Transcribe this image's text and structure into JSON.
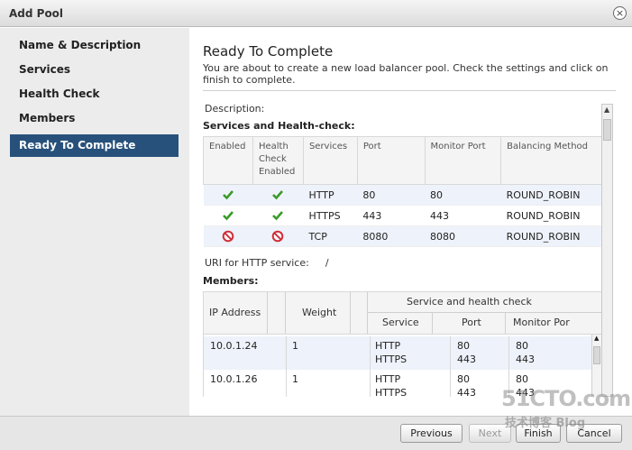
{
  "dialog": {
    "title": "Add Pool",
    "close_symbol": "×"
  },
  "sidebar": {
    "items": [
      {
        "label": "Name & Description"
      },
      {
        "label": "Services"
      },
      {
        "label": "Health Check"
      },
      {
        "label": "Members"
      },
      {
        "label": "Ready To Complete",
        "active": true
      }
    ]
  },
  "main": {
    "title": "Ready To Complete",
    "description": "You are about to create a new load balancer pool. Check the settings and click on finish to complete.",
    "description_field_label": "Description:",
    "services_section_title": "Services and Health-check:",
    "services_table": {
      "headers": [
        "Enabled",
        "Health Check Enabled",
        "Services",
        "Port",
        "Monitor Port",
        "Balancing Method"
      ],
      "rows": [
        {
          "enabled": "check-icon",
          "health": "check-icon",
          "service": "HTTP",
          "port": "80",
          "monitor_port": "80",
          "method": "ROUND_ROBIN"
        },
        {
          "enabled": "check-icon",
          "health": "check-icon",
          "service": "HTTPS",
          "port": "443",
          "monitor_port": "443",
          "method": "ROUND_ROBIN"
        },
        {
          "enabled": "disabled-icon",
          "health": "disabled-icon",
          "service": "TCP",
          "port": "8080",
          "monitor_port": "8080",
          "method": "ROUND_ROBIN"
        }
      ]
    },
    "uri_label": "URI for HTTP service:",
    "uri_value": "/",
    "members_section_title": "Members:",
    "members_table": {
      "headers": {
        "ip": "IP Address",
        "weight": "Weight",
        "group": "Service and health check",
        "service": "Service",
        "port": "Port",
        "monitor_port": "Monitor Por"
      },
      "rows": [
        {
          "ip": "10.0.1.24",
          "weight": "1",
          "service_1": "HTTP",
          "service_2": "HTTPS",
          "port_1": "80",
          "port_2": "443",
          "monitor_1": "80",
          "monitor_2": "443"
        },
        {
          "ip": "10.0.1.26",
          "weight": "1",
          "service_1": "HTTP",
          "service_2": "HTTPS",
          "port_1": "80",
          "port_2": "443",
          "monitor_1": "80",
          "monitor_2": "443"
        }
      ]
    }
  },
  "footer": {
    "previous_label": "Previous",
    "next_label": "Next",
    "finish_label": "Finish",
    "cancel_label": "Cancel"
  },
  "watermark": {
    "main": "51CTO.com",
    "sub": "技术博客 Blog"
  },
  "colors": {
    "accent": "#27517b",
    "check": "#3a9a2a",
    "disabled": "#d0303a",
    "row_alt": "#eef2fa"
  }
}
